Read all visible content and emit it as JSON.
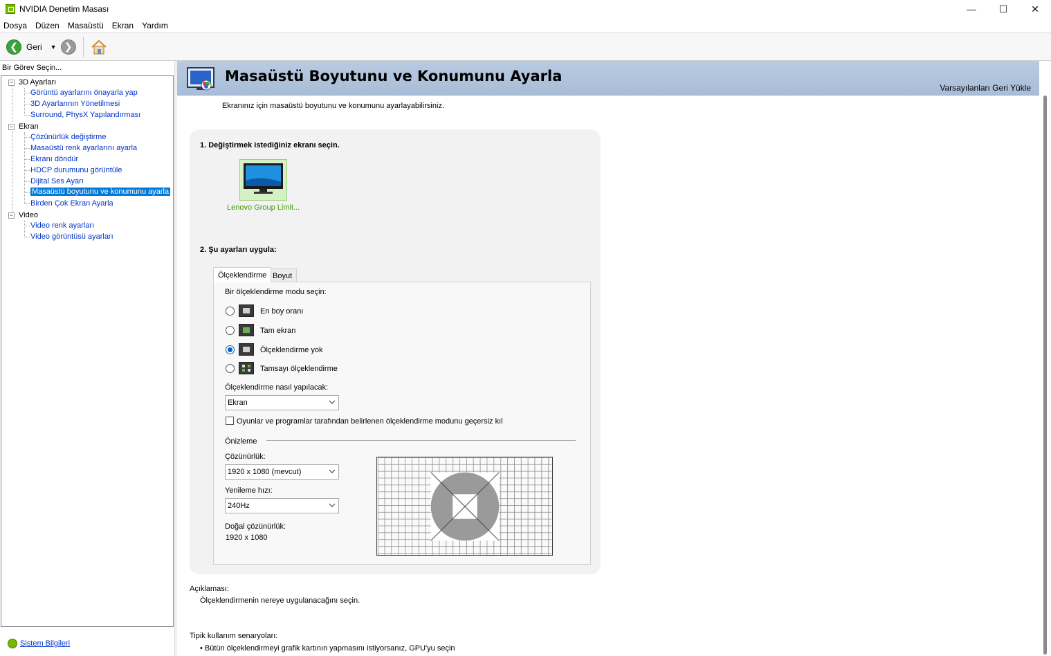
{
  "window": {
    "title": "NVIDIA Denetim Masası",
    "minimize": "—",
    "maximize": "☐",
    "close": "✕"
  },
  "menu": [
    "Dosya",
    "Düzen",
    "Masaüstü",
    "Ekran",
    "Yardım"
  ],
  "toolbar": {
    "back_label": "Geri"
  },
  "left": {
    "label": "Bir Görev Seçin...",
    "groups": [
      {
        "label": "3D Ayarları",
        "items": [
          "Görüntü ayarlarını önayarla yap",
          "3D Ayarlarının Yönetilmesi",
          "Surround, PhysX Yapılandırması"
        ]
      },
      {
        "label": "Ekran",
        "items": [
          "Çözünürlük değiştirme",
          "Masaüstü renk ayarlarını ayarla",
          "Ekranı döndür",
          "HDCP durumunu görüntüle",
          "Dijital Ses Ayarı",
          "Masaüstü boyutunu ve konumunu ayarla",
          "Birden Çok Ekran Ayarla"
        ]
      },
      {
        "label": "Video",
        "items": [
          "Video renk ayarları",
          "Video görüntüsü ayarları"
        ]
      }
    ],
    "selected": "Masaüstü boyutunu ve konumunu ayarla",
    "system_info": "Sistem Bilgileri"
  },
  "header": {
    "title": "Masaüstü Boyutunu ve Konumunu Ayarla",
    "restore_defaults": "Varsayılanları Geri Yükle"
  },
  "intro": "Ekranınız için masaüstü boyutunu ve konumunu ayarlayabilirsiniz.",
  "section1": {
    "title": "1. Değiştirmek istediğiniz ekranı seçin.",
    "display_name": "Lenovo Group Limit..."
  },
  "section2": {
    "title": "2. Şu ayarları uygula:",
    "tabs": [
      "Ölçeklendirme",
      "Boyut"
    ],
    "mode_prompt": "Bir ölçeklendirme modu seçin:",
    "modes": [
      {
        "label": "En boy oranı",
        "selected": false
      },
      {
        "label": "Tam ekran",
        "selected": false
      },
      {
        "label": "Ölçeklendirme yok",
        "selected": true
      },
      {
        "label": "Tamsayı ölçeklendirme",
        "selected": false
      }
    ],
    "scaling_on_label": "Ölçeklendirme nasıl yapılacak:",
    "scaling_on_value": "Ekran",
    "override_label": "Oyunlar ve programlar tarafından belirlenen ölçeklendirme modunu geçersiz kıl",
    "override_checked": false,
    "preview_label": "Önizleme",
    "resolution_label": "Çözünürlük:",
    "resolution_value": "1920 x 1080 (mevcut)",
    "refresh_label": "Yenileme hızı:",
    "refresh_value": "240Hz",
    "native_label": "Doğal çözünürlük:",
    "native_value": "1920 x 1080"
  },
  "description": {
    "label": "Açıklaması:",
    "text": "Ölçeklendirmenin nereye uygulanacağını seçin."
  },
  "usage": {
    "label": "Tipik kullanım senaryoları:",
    "items": [
      "Bütün ölçeklendirmeyi grafik kartının yapmasını istiyorsanız, GPU'yu seçin"
    ]
  },
  "colors": {
    "accent_green": "#76b900",
    "link_blue": "#0033cc",
    "selection_blue": "#0078d7",
    "header_blue": "#b9cbe2"
  }
}
